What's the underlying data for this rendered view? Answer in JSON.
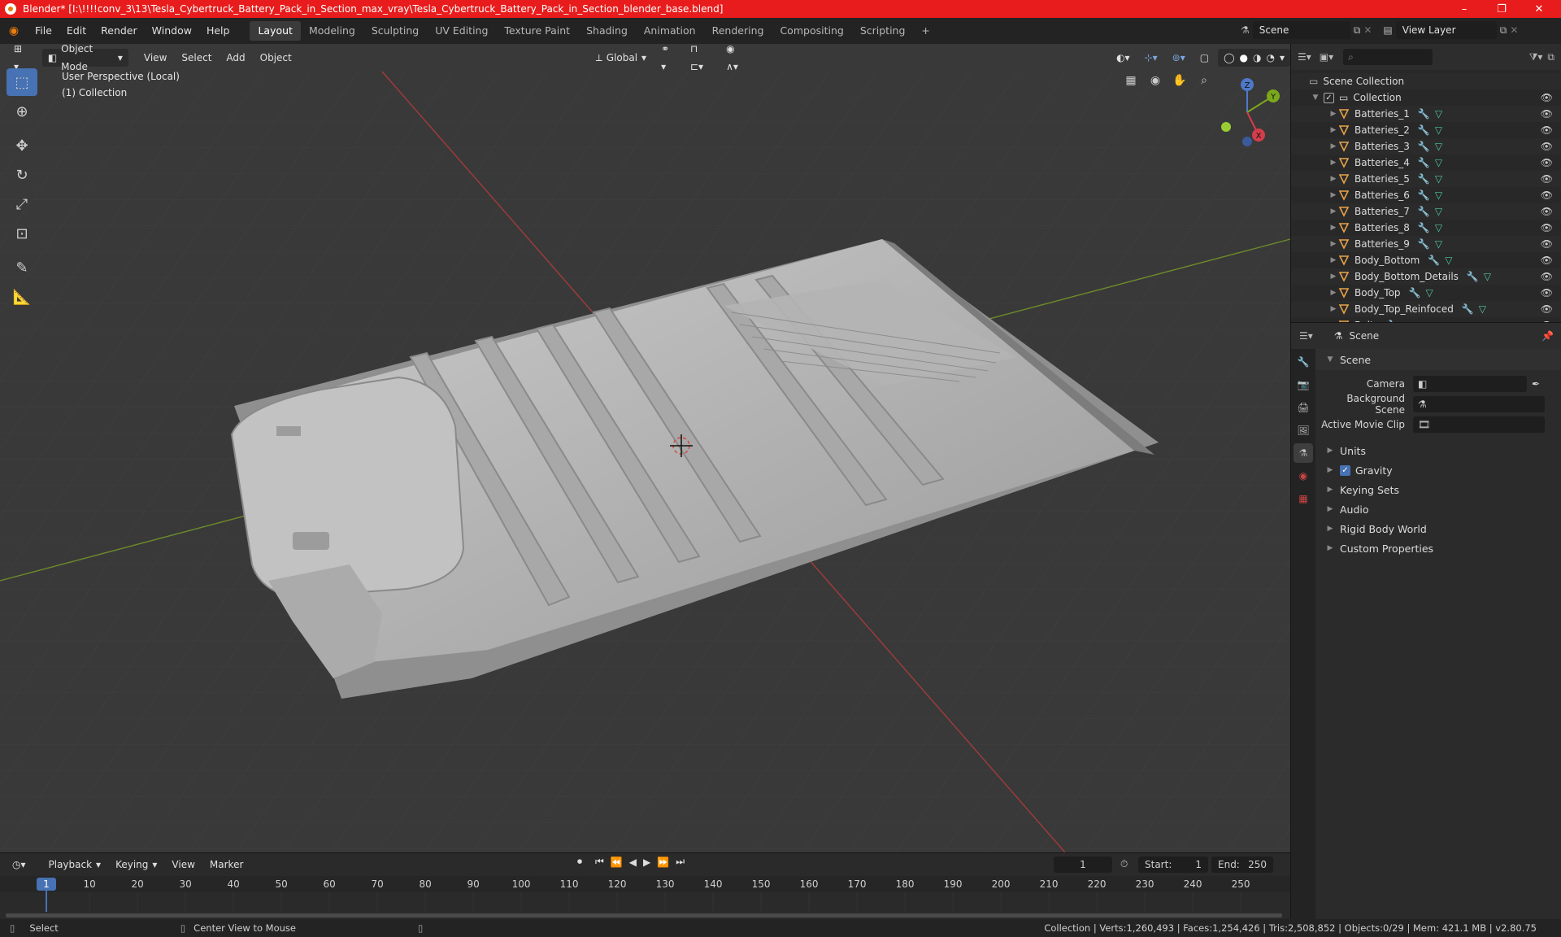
{
  "titlebar": {
    "title": "Blender* [I:\\!!!!conv_3\\13\\Tesla_Cybertruck_Battery_Pack_in_Section_max_vray\\Tesla_Cybertruck_Battery_Pack_in_Section_blender_base.blend]",
    "minimize": "–",
    "maximize": "❐",
    "close": "✕"
  },
  "menus": [
    "File",
    "Edit",
    "Render",
    "Window",
    "Help"
  ],
  "workspaces": [
    "Layout",
    "Modeling",
    "Sculpting",
    "UV Editing",
    "Texture Paint",
    "Shading",
    "Animation",
    "Rendering",
    "Compositing",
    "Scripting"
  ],
  "active_workspace": "Layout",
  "top_right": {
    "scene": "Scene",
    "view_layer": "View Layer"
  },
  "viewport": {
    "mode": "Object Mode",
    "menus": [
      "View",
      "Select",
      "Add",
      "Object"
    ],
    "orientation": "Global",
    "overlay_line1": "User Perspective (Local)",
    "overlay_line2": "(1) Collection",
    "gizmo": {
      "x": "X",
      "y": "Y",
      "z": "Z"
    }
  },
  "outliner": {
    "root": "Scene Collection",
    "collection": "Collection",
    "items": [
      "Batteries_1",
      "Batteries_2",
      "Batteries_3",
      "Batteries_4",
      "Batteries_5",
      "Batteries_6",
      "Batteries_7",
      "Batteries_8",
      "Batteries_9",
      "Body_Bottom",
      "Body_Bottom_Details",
      "Body_Top",
      "Body_Top_Reinfoced",
      "Bolts"
    ]
  },
  "properties": {
    "header": "Scene",
    "section": "Scene",
    "camera_label": "Camera",
    "background_scene_label": "Background Scene",
    "active_movie_clip_label": "Active Movie Clip",
    "panels": [
      "Units",
      "Gravity",
      "Keying Sets",
      "Audio",
      "Rigid Body World",
      "Custom Properties"
    ],
    "gravity_checked": true
  },
  "timeline": {
    "menus": [
      "Playback",
      "Keying",
      "View",
      "Marker"
    ],
    "current_frame": "1",
    "start_label": "Start:",
    "start": "1",
    "end_label": "End:",
    "end": "250",
    "ticks": [
      "1",
      "10",
      "20",
      "30",
      "40",
      "50",
      "60",
      "70",
      "80",
      "90",
      "100",
      "110",
      "120",
      "130",
      "140",
      "150",
      "160",
      "170",
      "180",
      "190",
      "200",
      "210",
      "220",
      "230",
      "240",
      "250"
    ]
  },
  "statusbar": {
    "select": "Select",
    "center_view": "Center View to Mouse",
    "stats": "Collection | Verts:1,260,493 | Faces:1,254,426 | Tris:2,508,852 | Objects:0/29 | Mem: 421.1 MB | v2.80.75"
  }
}
